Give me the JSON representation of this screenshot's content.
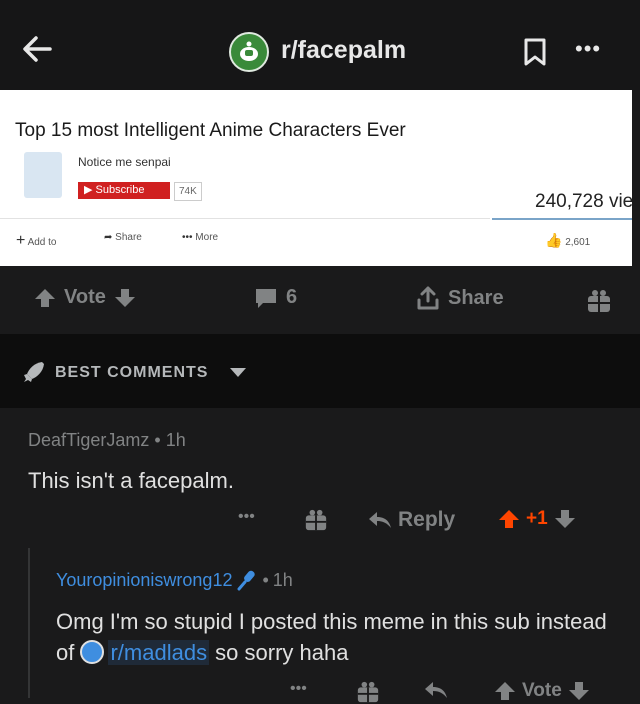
{
  "header": {
    "subreddit": "r/facepalm",
    "more_label": "•••"
  },
  "post_image": {
    "title": "Top 15 most Intelligent Anime Characters Ever",
    "channel_name": "Notice me senpai",
    "subscribe_label": "Subscribe",
    "subscriber_count": "74K",
    "views": "240,728 vie",
    "add_to_label": "Add to",
    "share_label": "Share",
    "more_label": "More",
    "like_count": "2,601"
  },
  "actions": {
    "vote_label": "Vote",
    "comment_count": "6",
    "share_label": "Share"
  },
  "comments_header": {
    "sort_label": "BEST COMMENTS"
  },
  "comment": {
    "author": "DeafTigerJamz",
    "time": "1h",
    "body": "This isn't a facepalm.",
    "more_label": "•••",
    "reply_label": "Reply",
    "score": "+1"
  },
  "reply": {
    "author": "Youropinioniswrong12",
    "time": "1h",
    "body_before": "Omg I'm so stupid I posted this meme in this sub instead of ",
    "link_label": "r/madlads",
    "body_after": " so sorry haha",
    "more_label": "•••",
    "vote_label": "Vote"
  },
  "colors": {
    "upvote": "#ff4500",
    "link": "#3f8ee0",
    "background": "#1a1a1b"
  }
}
